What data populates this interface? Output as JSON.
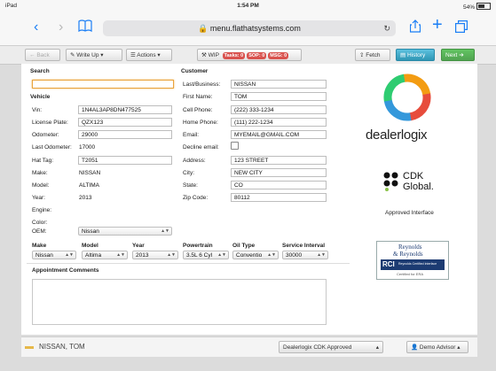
{
  "status": {
    "device": "iPad",
    "time": "1:54 PM",
    "battery": "54%"
  },
  "browser": {
    "url": "menu.flathatsystems.com"
  },
  "toolbar": {
    "back": "Back",
    "write_up": "Write Up",
    "actions": "Actions",
    "wip": "WIP",
    "tasks": "Tasks: 0",
    "sop": "SOP: 0",
    "msg": "MSG: 0",
    "fetch": "Fetch",
    "history": "History",
    "next": "Next"
  },
  "search": {
    "label": "Search",
    "value": ""
  },
  "vehicle": {
    "title": "Vehicle",
    "vin_label": "Vin:",
    "vin": "1N4AL3AP8DN477525",
    "plate_label": "License Plate:",
    "plate": "QZX123",
    "odometer_label": "Odometer:",
    "odometer": "29000",
    "last_odometer_label": "Last Odometer:",
    "last_odometer": "17000",
    "hat_tag_label": "Hat Tag:",
    "hat_tag": "T2051",
    "make_label": "Make:",
    "make": "NISSAN",
    "model_label": "Model:",
    "model": "ALTIMA",
    "year_label": "Year:",
    "year": "2013",
    "engine_label": "Engine:",
    "engine": "",
    "color_label": "Color:",
    "color": "",
    "oem_label": "OEM:",
    "oem": "Nissan"
  },
  "customer": {
    "title": "Customer",
    "last_business_label": "Last/Business:",
    "last_business": "NISSAN",
    "first_name_label": "First Name:",
    "first_name": "TOM",
    "cell_label": "Cell Phone:",
    "cell": "(222) 333-1234",
    "home_label": "Home Phone:",
    "home": "(111) 222-1234",
    "email_label": "Email:",
    "email": "MYEMAIL@GMAIL.COM",
    "decline_email_label": "Decline email:",
    "address_label": "Address:",
    "address": "123 STREET",
    "city_label": "City:",
    "city": "NEW CITY",
    "state_label": "State:",
    "state": "CO",
    "zip_label": "Zip Code:",
    "zip": "80112"
  },
  "selectors": {
    "make_label": "Make",
    "make": "Nissan",
    "model_label": "Model",
    "model": "Altima",
    "year_label": "Year",
    "year": "2013",
    "powertrain_label": "Powertrain",
    "powertrain": "3.5L 6 Cyl",
    "oil_label": "Oil Type",
    "oil": "Conventio",
    "interval_label": "Service Interval",
    "interval": "30000"
  },
  "comments": {
    "label": "Appointment Comments",
    "value": ""
  },
  "logos": {
    "dealerlogix": "dealerlogix",
    "cdk_line1": "CDK",
    "cdk_line2": "Global.",
    "cdk_caption": "Approved Interface",
    "rr_line1": "Reynolds",
    "rr_line2": "& Reynolds",
    "rr_rci": "RCI",
    "rr_sub": "Reynolds Certified Interface",
    "rr_cert": "Certified for ERA"
  },
  "footer": {
    "customer": "NISSAN, TOM",
    "status_select": "Dealerlogix CDK Approved",
    "advisor": "Demo Advisor"
  },
  "colors": {
    "accent": "#1a7ef5",
    "blue_btn": "#2f96b4",
    "green_btn": "#51a351",
    "badge": "#d9534f"
  }
}
